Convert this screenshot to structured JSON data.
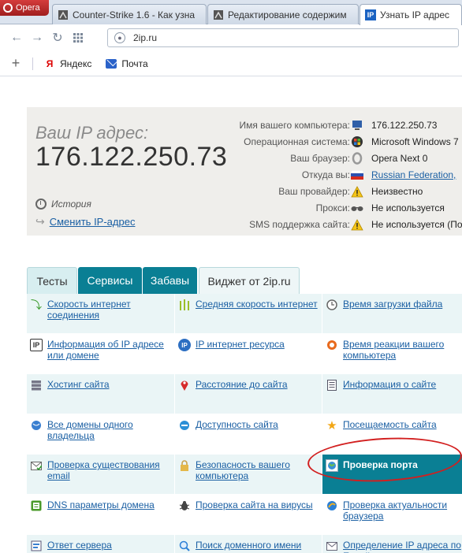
{
  "browser": {
    "opera_label": "Opera",
    "tabs": [
      {
        "label": "Counter-Strike 1.6 - Как узна",
        "icon": "cs-icon"
      },
      {
        "label": "Редактирование содержим",
        "icon": "cs-icon"
      },
      {
        "label": "Узнать IP адрес",
        "icon": "ip-icon"
      }
    ],
    "address": "2ip.ru",
    "bookmarks": [
      {
        "label": "Яндекс",
        "icon": "yandex-icon"
      },
      {
        "label": "Почта",
        "icon": "mail-icon"
      }
    ]
  },
  "ip_panel": {
    "caption": "Ваш IP адрес:",
    "ip": "176.122.250.73",
    "history_label": "История",
    "change_label": "Сменить IP-адрес"
  },
  "info": [
    {
      "label": "Имя вашего компьютера:",
      "value": "176.122.250.73",
      "icon": "computer-icon",
      "link": false
    },
    {
      "label": "Операционная система:",
      "value": "Microsoft Windows 7",
      "icon": "windows-icon",
      "link": false
    },
    {
      "label": "Ваш браузер:",
      "value": "Opera Next 0",
      "icon": "browser-icon",
      "link": false
    },
    {
      "label": "Откуда вы:",
      "value": "Russian Federation,",
      "icon": "flag-icon",
      "link": true
    },
    {
      "label": "Ваш провайдер:",
      "value": "Неизвестно",
      "icon": "warning-icon",
      "link": false
    },
    {
      "label": "Прокси:",
      "value": "Не используется",
      "icon": "glasses-icon",
      "link": false
    },
    {
      "label": "SMS поддержка сайта:",
      "value": "Не используется (По",
      "icon": "warning-icon",
      "link": false
    }
  ],
  "service_tabs": [
    "Тесты",
    "Сервисы",
    "Забавы",
    "Виджет от 2ip.ru"
  ],
  "services": [
    [
      "Скорость интернет соединения",
      "Средняя скорость интернет",
      "Время загрузки файла"
    ],
    [
      "Информация об IP адресе или домене",
      "IP интернет ресурса",
      "Время реакции вашего компьютера"
    ],
    [
      "Хостинг сайта",
      "Расстояние до сайта",
      "Информация о сайте"
    ],
    [
      "Все домены одного владельца",
      "Доступность сайта",
      "Посещаемость сайта"
    ],
    [
      "Проверка существования email",
      "Безопасность вашего компьютера",
      "Проверка порта"
    ],
    [
      "DNS параметры домена",
      "Проверка сайта на вирусы",
      "Проверка актуальности браузера"
    ],
    [
      "Ответ сервера",
      "Поиск доменного имени",
      "Определение IP адреса по E-mail"
    ]
  ],
  "colors": {
    "accent": "#0a7f94",
    "link": "#1a5fa3",
    "annotation": "#d21f1f"
  }
}
